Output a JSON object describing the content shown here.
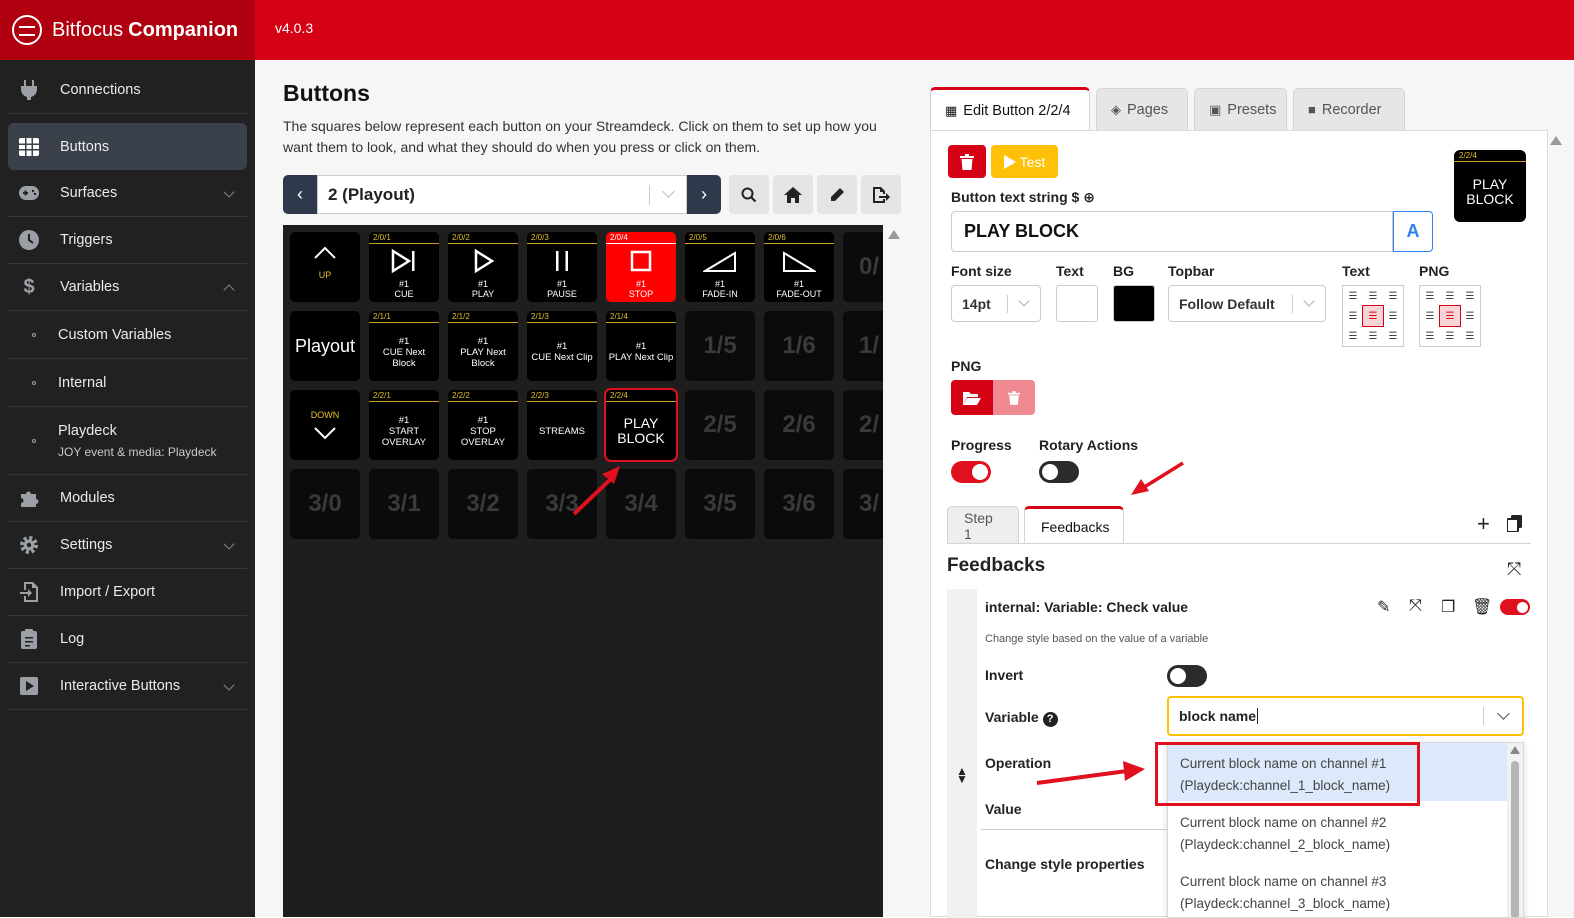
{
  "app": {
    "brand_light": "Bitfocus",
    "brand_bold": "Companion",
    "version": "v4.0.3",
    "accent_color": "#d50215"
  },
  "sidebar": {
    "items": [
      {
        "label": "Connections",
        "icon": "plug-icon"
      },
      {
        "label": "Buttons",
        "icon": "grid-icon",
        "active": true
      },
      {
        "label": "Surfaces",
        "icon": "gamepad-icon",
        "expandable": true
      },
      {
        "label": "Triggers",
        "icon": "clock-icon"
      },
      {
        "label": "Variables",
        "icon": "dollar-icon",
        "expanded": true
      },
      {
        "label": "Custom Variables",
        "sub": true
      },
      {
        "label": "Internal",
        "sub": true
      },
      {
        "label": "Playdeck",
        "sublabel": "JOY event & media: Playdeck",
        "sub": true
      },
      {
        "label": "Modules",
        "icon": "puzzle-icon"
      },
      {
        "label": "Settings",
        "icon": "gear-icon",
        "expandable": true
      },
      {
        "label": "Import / Export",
        "icon": "file-import-icon"
      },
      {
        "label": "Log",
        "icon": "clipboard-icon"
      },
      {
        "label": "Interactive Buttons",
        "icon": "play-square-icon",
        "expandable": true
      }
    ]
  },
  "buttons_page": {
    "title": "Buttons",
    "description": "The squares below represent each button on your Streamdeck. Click on them to set up how you want them to look, and what they should do when you press or click on them.",
    "page_select": "2 (Playout)",
    "tools": [
      "search-icon",
      "home-icon",
      "pencil-icon",
      "export-icon"
    ]
  },
  "grid": {
    "row0": [
      {
        "kind": "nav",
        "label": "UP"
      },
      {
        "top": "2/0/1",
        "glyph": "⏭",
        "cap1": "#1",
        "cap2": "CUE"
      },
      {
        "top": "2/0/2",
        "glyph": "▷",
        "cap1": "#1",
        "cap2": "PLAY"
      },
      {
        "top": "2/0/3",
        "glyph": "⏸",
        "cap1": "#1",
        "cap2": "PAUSE"
      },
      {
        "top": "2/0/4",
        "glyph": "☐",
        "cap1": "#1",
        "cap2": "STOP"
      },
      {
        "top": "2/0/5",
        "glyph": "◿",
        "cap1": "#1",
        "cap2": "FADE-IN"
      },
      {
        "top": "2/0/6",
        "glyph": "◺",
        "cap1": "#1",
        "cap2": "FADE-OUT"
      },
      {
        "empty": "0/"
      }
    ],
    "row1": [
      {
        "big": "Playout"
      },
      {
        "top": "2/1/1",
        "l1": "#1",
        "l2": "CUE Next",
        "l3": "Block"
      },
      {
        "top": "2/1/2",
        "l1": "#1",
        "l2": "PLAY Next",
        "l3": "Block"
      },
      {
        "top": "2/1/3",
        "l1": "#1",
        "l2": "CUE Next Clip",
        "l3": ""
      },
      {
        "top": "2/1/4",
        "l1": "#1",
        "l2": "PLAY Next Clip",
        "l3": ""
      },
      {
        "empty": "1/5"
      },
      {
        "empty": "1/6"
      },
      {
        "empty": "1/"
      }
    ],
    "row2": [
      {
        "kind": "nav",
        "label": "DOWN"
      },
      {
        "top": "2/2/1",
        "l1": "#1",
        "l2": "START",
        "l3": "OVERLAY"
      },
      {
        "top": "2/2/2",
        "l1": "#1",
        "l2": "STOP",
        "l3": "OVERLAY"
      },
      {
        "top": "2/2/3",
        "l1": "STREAMS",
        "l2": "",
        "l3": ""
      },
      {
        "top": "2/2/4",
        "l1": "PLAY",
        "l2": "BLOCK",
        "l3": "",
        "selected": true
      },
      {
        "empty": "2/5"
      },
      {
        "empty": "2/6"
      },
      {
        "empty": "2/"
      }
    ],
    "row3": [
      "3/0",
      "3/1",
      "3/2",
      "3/3",
      "3/4",
      "3/5",
      "3/6",
      "3/"
    ]
  },
  "edit": {
    "tabs": [
      {
        "label": "Edit Button 2/2/4",
        "icon": "calculator-icon",
        "active": true
      },
      {
        "label": "Pages",
        "icon": "layers-icon"
      },
      {
        "label": "Presets",
        "icon": "gift-icon"
      },
      {
        "label": "Recorder",
        "icon": "video-icon"
      }
    ],
    "test_label": "Test",
    "preview_top": "2/2/4",
    "preview_l1": "PLAY",
    "preview_l2": "BLOCK",
    "button_text_label": "Button text string",
    "button_text_value": "PLAY BLOCK",
    "font_btn_label": "A",
    "font_size_label": "Font size",
    "font_size_value": "14pt",
    "text_label": "Text",
    "bg_label": "BG",
    "topbar_label": "Topbar",
    "topbar_value": "Follow Default",
    "text_align_label": "Text",
    "png_align_label": "PNG",
    "png_label": "PNG",
    "progress_label": "Progress",
    "rotary_label": "Rotary Actions",
    "text_color": "#ffffff",
    "bg_color": "#000000"
  },
  "subtabs": [
    {
      "label": "Step 1"
    },
    {
      "label": "Feedbacks",
      "active": true
    }
  ],
  "feedbacks": {
    "title": "Feedbacks",
    "item_name": "internal: Variable: Check value",
    "item_desc": "Change style based on the value of a variable",
    "invert_label": "Invert",
    "variable_label": "Variable",
    "variable_input": "block name",
    "operation_label": "Operation",
    "value_label": "Value",
    "change_style_label": "Change style properties",
    "options": [
      {
        "line1": "Current block name on channel #1",
        "line2": "(Playdeck:channel_1_block_name)",
        "highlight": true
      },
      {
        "line1": "Current block name on channel #2",
        "line2": "(Playdeck:channel_2_block_name)"
      },
      {
        "line1": "Current block name on channel #3",
        "line2": "(Playdeck:channel_3_block_name)"
      }
    ]
  }
}
